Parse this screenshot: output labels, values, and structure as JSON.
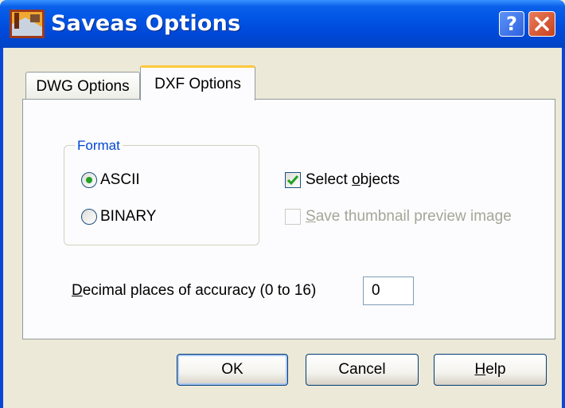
{
  "window": {
    "title": "Saveas Options"
  },
  "titlebar_buttons": {
    "help": "?",
    "close": "close"
  },
  "tabs": [
    {
      "label": "DWG Options",
      "active": false
    },
    {
      "label": "DXF Options",
      "active": true
    }
  ],
  "format_group": {
    "label": "Format",
    "options": [
      {
        "label": "ASCII",
        "selected": true
      },
      {
        "label": "BINARY",
        "selected": false
      }
    ]
  },
  "checkboxes": [
    {
      "label_before": "Select ",
      "mnemonic": "o",
      "label_after": "bjects",
      "checked": true,
      "enabled": true
    },
    {
      "label_before": "",
      "mnemonic": "S",
      "label_after": "ave thumbnail preview image",
      "checked": false,
      "enabled": false
    }
  ],
  "decimal": {
    "mnemonic": "D",
    "label_rest": "ecimal places of accuracy (0 to 16)",
    "value": "0"
  },
  "buttons": {
    "ok": "OK",
    "cancel": "Cancel",
    "help_mnemonic": "H",
    "help_rest": "elp"
  },
  "colors": {
    "titlebar": "#0055E5",
    "group_label": "#0046D5",
    "tab_highlight": "#FFC83C",
    "check_mark": "#21A121"
  }
}
